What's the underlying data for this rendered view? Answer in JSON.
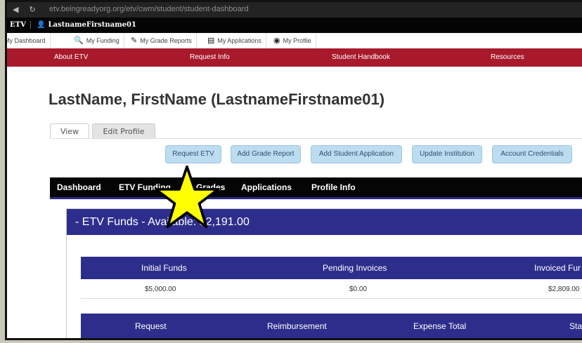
{
  "browser": {
    "url": "etv.beingreadyorg.org/etv/cwm/student/student-dashboard"
  },
  "appbar": {
    "brand": "ETV",
    "username": "LastnameFirstname01"
  },
  "quick_links": [
    {
      "label": "My Dashboard",
      "icon": "dashboard-icon"
    },
    {
      "label": "My Funding",
      "icon": "search-money-icon"
    },
    {
      "label": "My Grade Reports",
      "icon": "pencil-icon"
    },
    {
      "label": "My Applications",
      "icon": "clipboard-icon"
    },
    {
      "label": "My Profile",
      "icon": "user-circle-icon"
    }
  ],
  "red_nav": [
    "About ETV",
    "Request Info",
    "Student Handbook",
    "Resources"
  ],
  "page_title": "LastName, FirstName (LastnameFirstname01)",
  "tabs": {
    "view": "View",
    "edit": "Edit Profile"
  },
  "actions": [
    "Request ETV",
    "Add Grade Report",
    "Add Student Application",
    "Update Institution",
    "Account Credentials"
  ],
  "menu": {
    "items": [
      "Dashboard",
      "ETV Funding",
      "Grades",
      "Applications",
      "Profile Info"
    ],
    "active": "ETV Funding"
  },
  "funds_panel": {
    "heading": "- ETV Funds - Available: $2,191.00",
    "summary_headers": [
      "Initial Funds",
      "Pending Invoices",
      "Invoiced Fur"
    ],
    "summary_values": [
      "$5,000.00",
      "$0.00",
      "$2,809.00"
    ],
    "request_headers": [
      "Request",
      "Reimbursement",
      "Expense Total",
      "Sta"
    ]
  },
  "annotation": {
    "star_color": "#ffff00"
  },
  "colors": {
    "red_nav": "#a8192c",
    "panel_blue": "#2d2e8c",
    "button_blue": "#bcdcf0"
  }
}
